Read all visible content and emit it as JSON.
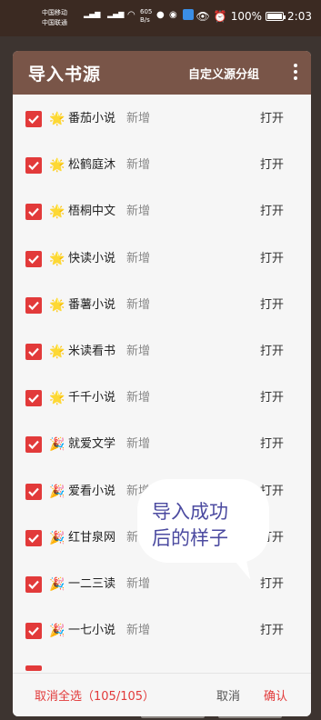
{
  "status_bar": {
    "carrier1": "中国移动",
    "carrier2": "中国联通",
    "speed": "605",
    "speed_unit": "B/s",
    "battery": "100%",
    "time": "2:03"
  },
  "dialog": {
    "title": "导入书源",
    "custom_group_label": "自定义源分组",
    "more_icon": "more-vert-icon",
    "accent_color": "#795548",
    "checkbox_color": "#e23a3a"
  },
  "sources": [
    {
      "emoji": "🌟",
      "name": "番茄小说",
      "status": "新增",
      "action": "打开",
      "checked": true
    },
    {
      "emoji": "🌟",
      "name": "松鹤庭沐",
      "status": "新增",
      "action": "打开",
      "checked": true
    },
    {
      "emoji": "🌟",
      "name": "梧桐中文",
      "status": "新增",
      "action": "打开",
      "checked": true
    },
    {
      "emoji": "🌟",
      "name": "快读小说",
      "status": "新增",
      "action": "打开",
      "checked": true
    },
    {
      "emoji": "🌟",
      "name": "番薯小说",
      "status": "新增",
      "action": "打开",
      "checked": true
    },
    {
      "emoji": "🌟",
      "name": "米读看书",
      "status": "新增",
      "action": "打开",
      "checked": true
    },
    {
      "emoji": "🌟",
      "name": "千千小说",
      "status": "新增",
      "action": "打开",
      "checked": true
    },
    {
      "emoji": "🎉",
      "name": "就爱文学",
      "status": "新增",
      "action": "打开",
      "checked": true
    },
    {
      "emoji": "🎉",
      "name": "爱看小说",
      "status": "新增",
      "action": "打开",
      "checked": true
    },
    {
      "emoji": "🎉",
      "name": "红甘泉网",
      "status": "新增",
      "action": "打开",
      "checked": true
    },
    {
      "emoji": "🎉",
      "name": "一二三读",
      "status": "新增",
      "action": "打开",
      "checked": true
    },
    {
      "emoji": "🎉",
      "name": "一七小说",
      "status": "新增",
      "action": "打开",
      "checked": true
    }
  ],
  "footer": {
    "deselect_all": "取消全选（105/105）",
    "cancel": "取消",
    "confirm": "确认"
  },
  "annotation": {
    "line1": "导入成功",
    "line2": "后的样子"
  }
}
